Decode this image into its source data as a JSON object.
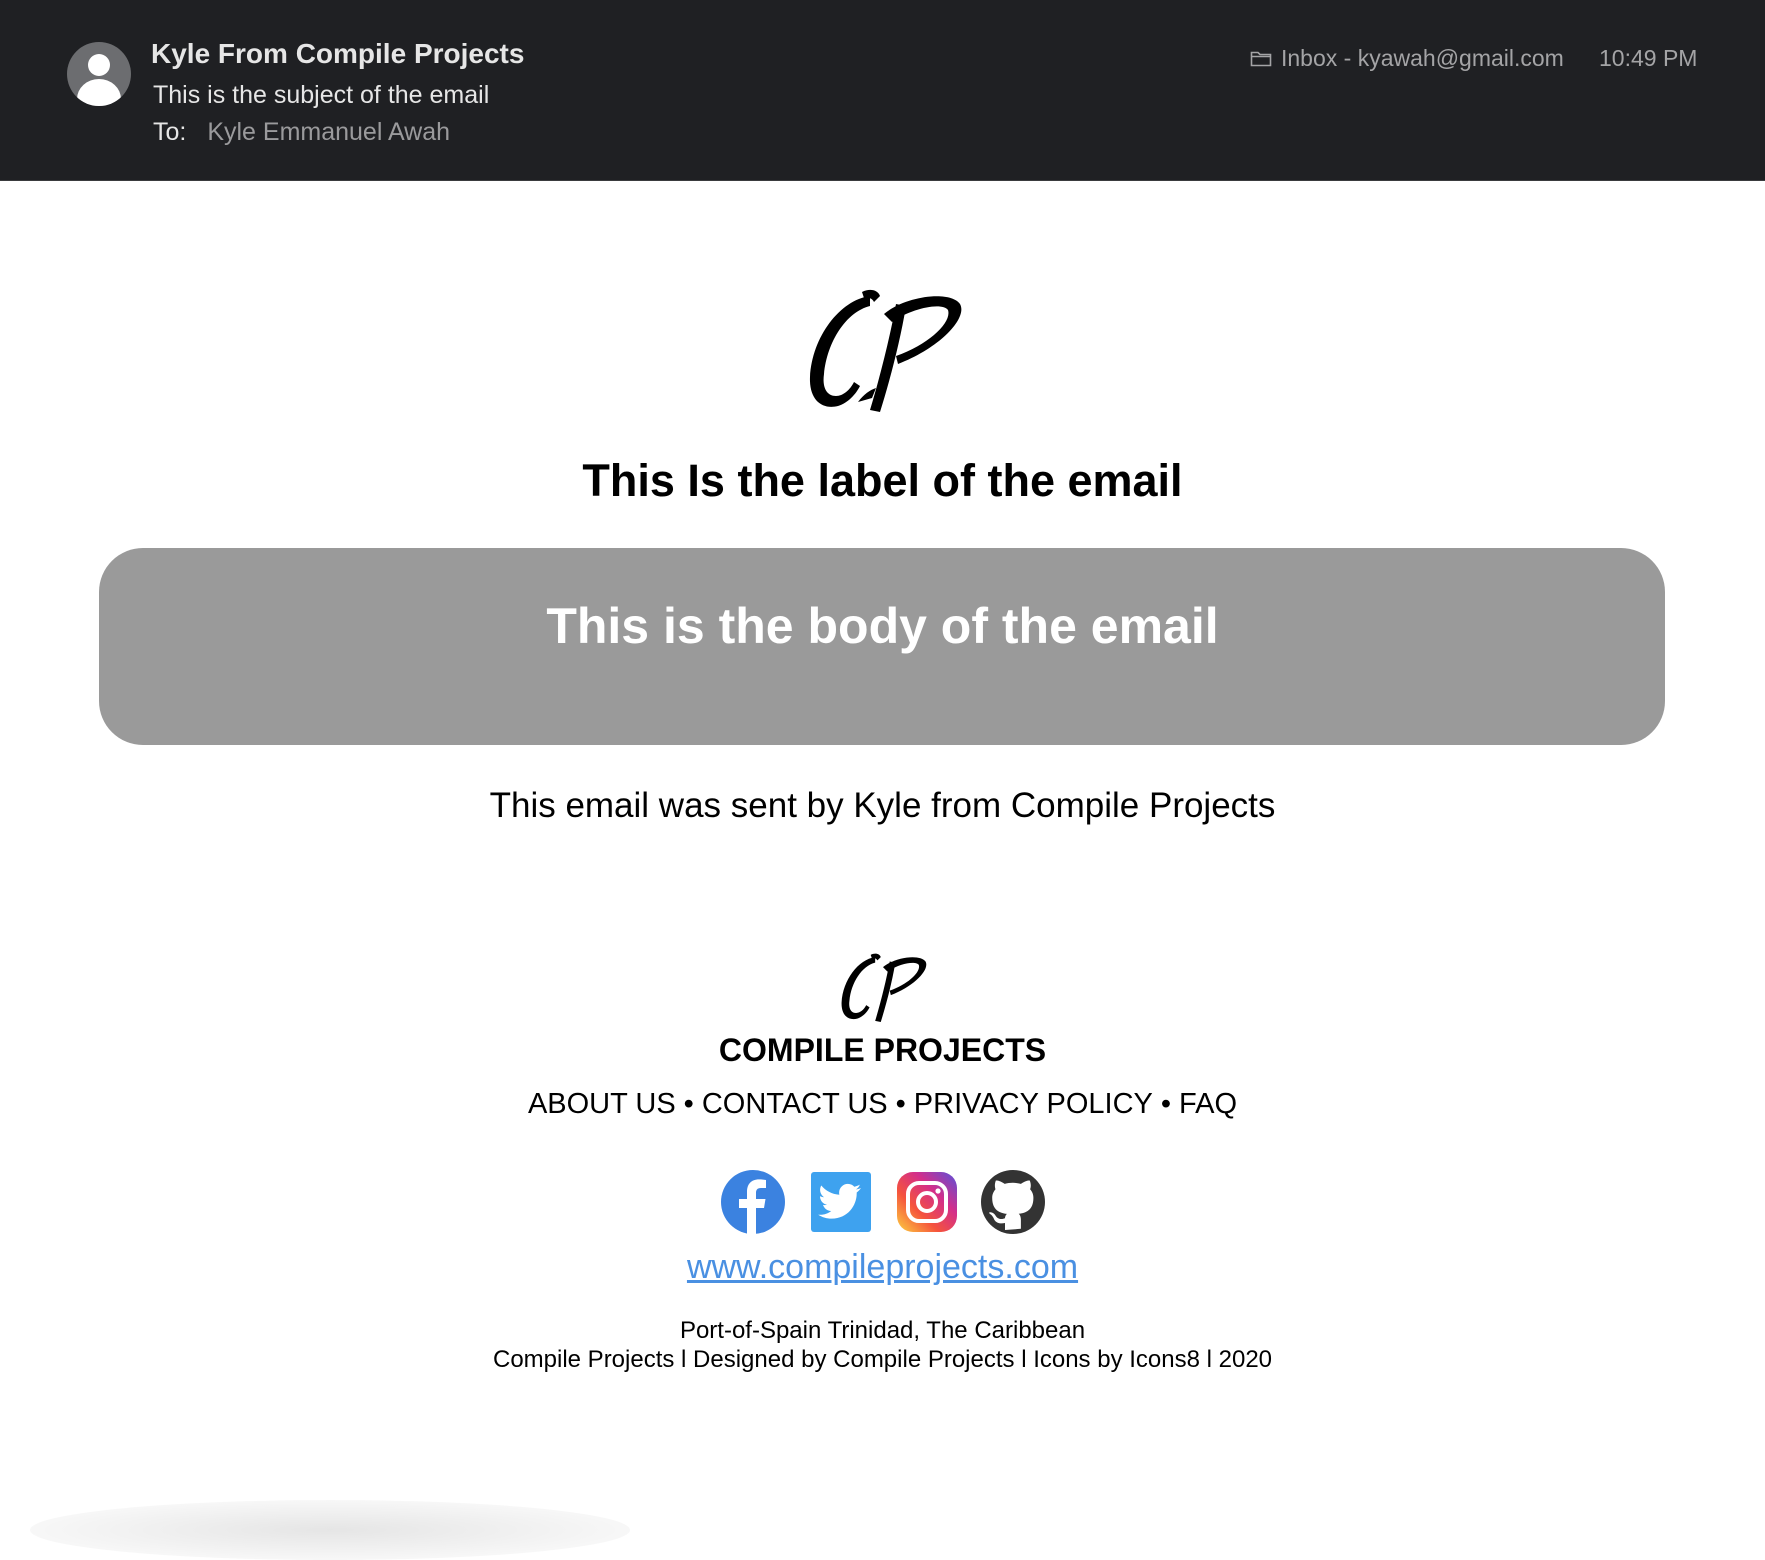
{
  "header": {
    "sender_name": "Kyle From Compile Projects",
    "subject": "This is the subject of the email",
    "to_label": "To:",
    "to_value": "Kyle Emmanuel Awah",
    "mailbox": "Inbox - kyawah@gmail.com",
    "time": "10:49 PM"
  },
  "body": {
    "logo_text": "CP",
    "label": "This Is the label of the email",
    "body_text": "This is the body of the email",
    "sent_by": "This email was sent by Kyle from Compile Projects"
  },
  "footer": {
    "logo_text": "CP",
    "brand": "COMPILE PROJECTS",
    "nav": [
      "ABOUT US",
      "CONTACT US",
      "PRIVACY POLICY",
      "FAQ"
    ],
    "nav_separator": "•",
    "social": [
      "facebook-icon",
      "twitter-icon",
      "instagram-icon",
      "github-icon"
    ],
    "website": "www.compileprojects.com",
    "address": "Port-of-Spain Trinidad, The Caribbean",
    "credits": "Compile Projects l Designed by Compile Projects l Icons by Icons8 l 2020"
  },
  "colors": {
    "header_bg": "#1f2023",
    "body_box": "#9a9a9a",
    "link": "#4a90e2",
    "facebook": "#3b82e0",
    "twitter": "#3ea2ef",
    "github": "#333333"
  }
}
